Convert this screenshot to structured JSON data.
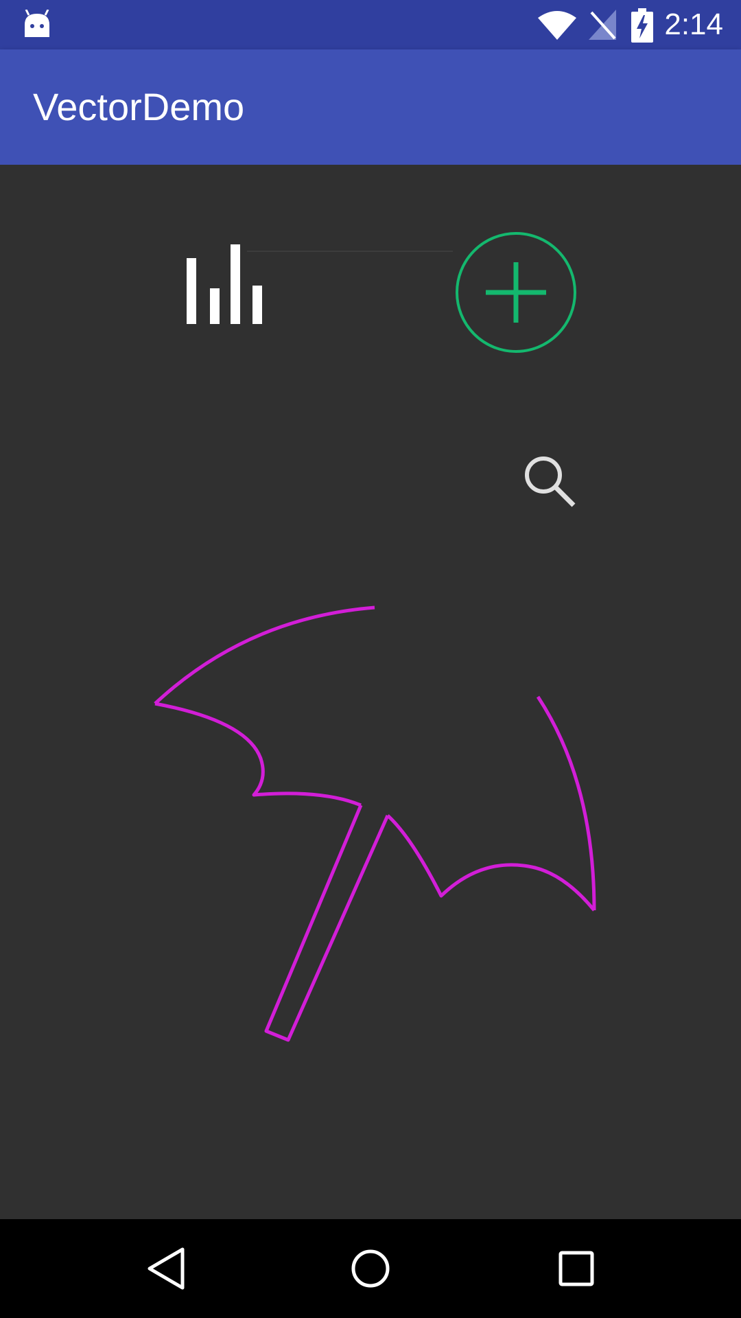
{
  "status_bar": {
    "time": "2:14",
    "icons": [
      "android-icon",
      "wifi-icon",
      "no-signal-icon",
      "battery-charging-icon"
    ]
  },
  "app_bar": {
    "title": "VectorDemo"
  },
  "content": {
    "icons": [
      "equalizer-icon",
      "add-circle-icon",
      "search-icon",
      "umbrella-icon"
    ]
  },
  "nav_bar": {
    "buttons": [
      "back-button",
      "home-button",
      "recents-button"
    ]
  },
  "colors": {
    "status_bar": "#303F9F",
    "app_bar": "#3F51B5",
    "background": "#303030",
    "add_circle": "#14B86E",
    "umbrella": "#D21ED7",
    "icon_white": "#FFFFFF",
    "search_gray": "#E0E0E0"
  }
}
